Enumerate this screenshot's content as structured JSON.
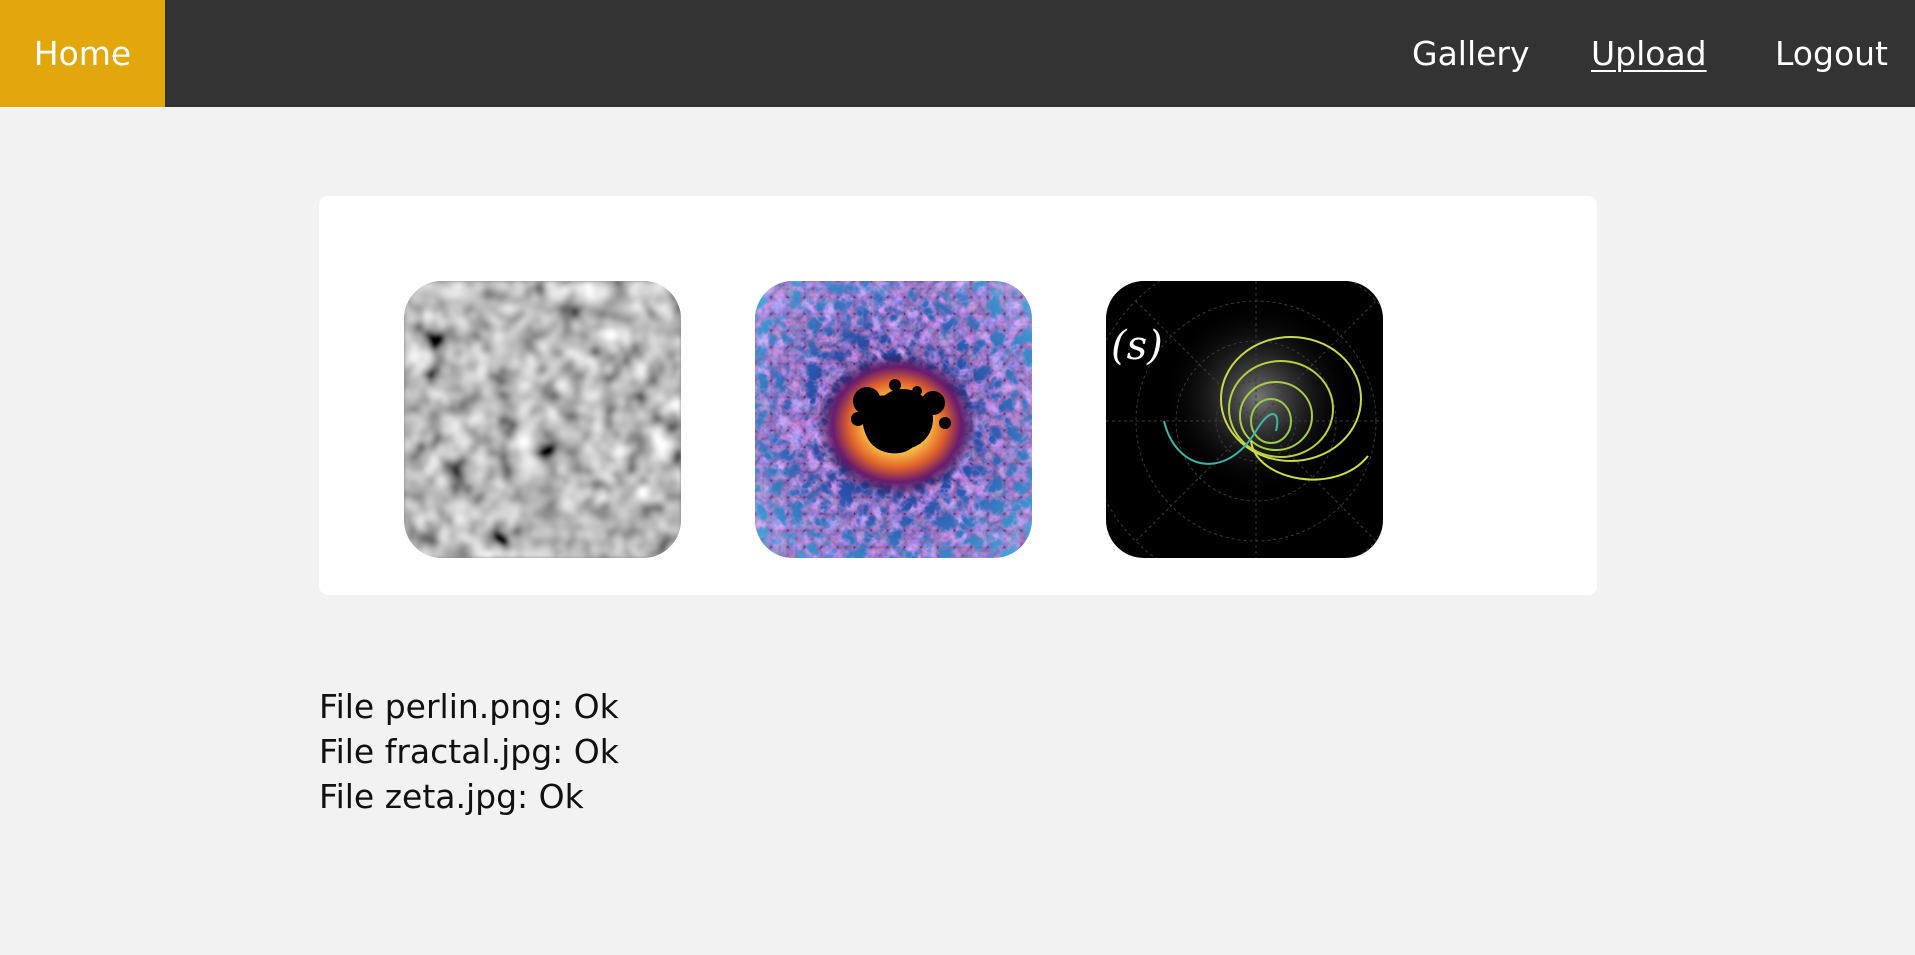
{
  "nav": {
    "home_label": "Home",
    "links": [
      {
        "label": "Gallery"
      },
      {
        "label": "Upload"
      },
      {
        "label": "Logout"
      }
    ],
    "active": "Upload",
    "colors": {
      "bar": "#333333",
      "home": "#e2a80b",
      "text": "#ffffff"
    }
  },
  "thumbnails": [
    {
      "icon": "perlin-noise-image",
      "filename": "perlin.png"
    },
    {
      "icon": "mandelbrot-fractal-image",
      "filename": "fractal.jpg"
    },
    {
      "icon": "zeta-function-plot-image",
      "filename": "zeta.jpg",
      "overlay_text": "(s)"
    }
  ],
  "results": [
    {
      "text": "File perlin.png: Ok"
    },
    {
      "text": "File fractal.jpg: Ok"
    },
    {
      "text": "File zeta.jpg: Ok"
    }
  ]
}
